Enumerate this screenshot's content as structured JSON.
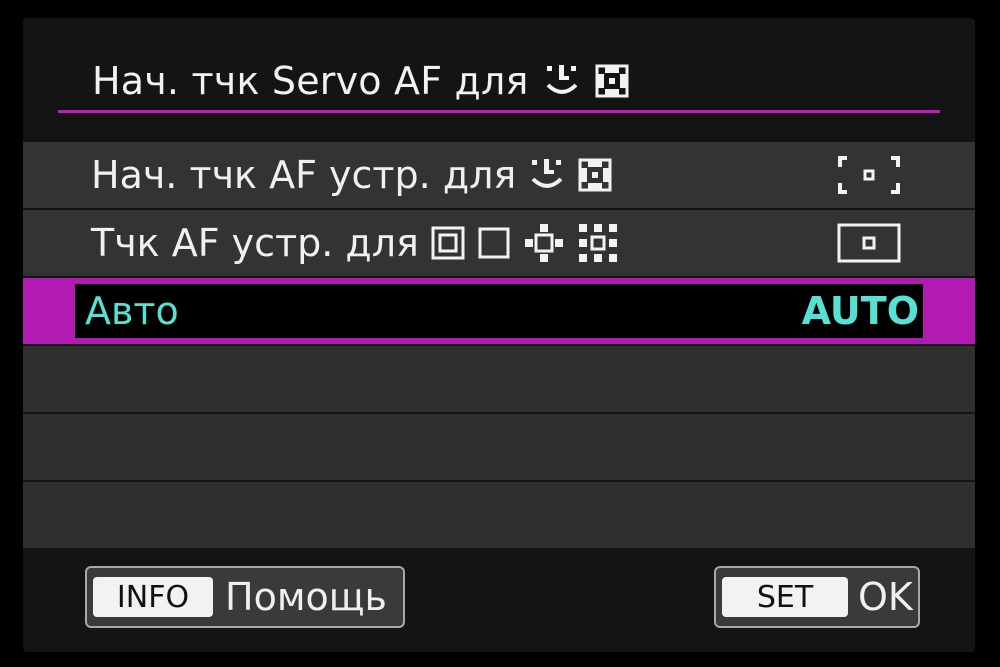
{
  "header": {
    "title": "Нач. тчк Servo AF для",
    "icons": [
      "face-tracking-icon",
      "af-zone-icon"
    ]
  },
  "menu": {
    "items": [
      {
        "label": "Нач. тчк AF устр. для",
        "icons": [
          "face-tracking-icon",
          "af-zone-icon"
        ],
        "value_icon": "af-start-point-bracket-icon"
      },
      {
        "label": "Тчк AF устр. для",
        "icons": [
          "spot-af-icon",
          "single-point-af-icon",
          "expand-af-icon",
          "expand-surround-af-icon"
        ],
        "value_icon": "af-point-frame-icon"
      },
      {
        "label": "Авто",
        "value": "AUTO",
        "selected": true
      }
    ]
  },
  "footer": {
    "info_key": "INFO",
    "info_label": "Помощь",
    "set_key": "SET",
    "set_label": "OK"
  },
  "colors": {
    "accent": "#b21ab1",
    "selected_text": "#57e0d4",
    "row_bg": "#333333",
    "screen_bg": "#141414"
  }
}
